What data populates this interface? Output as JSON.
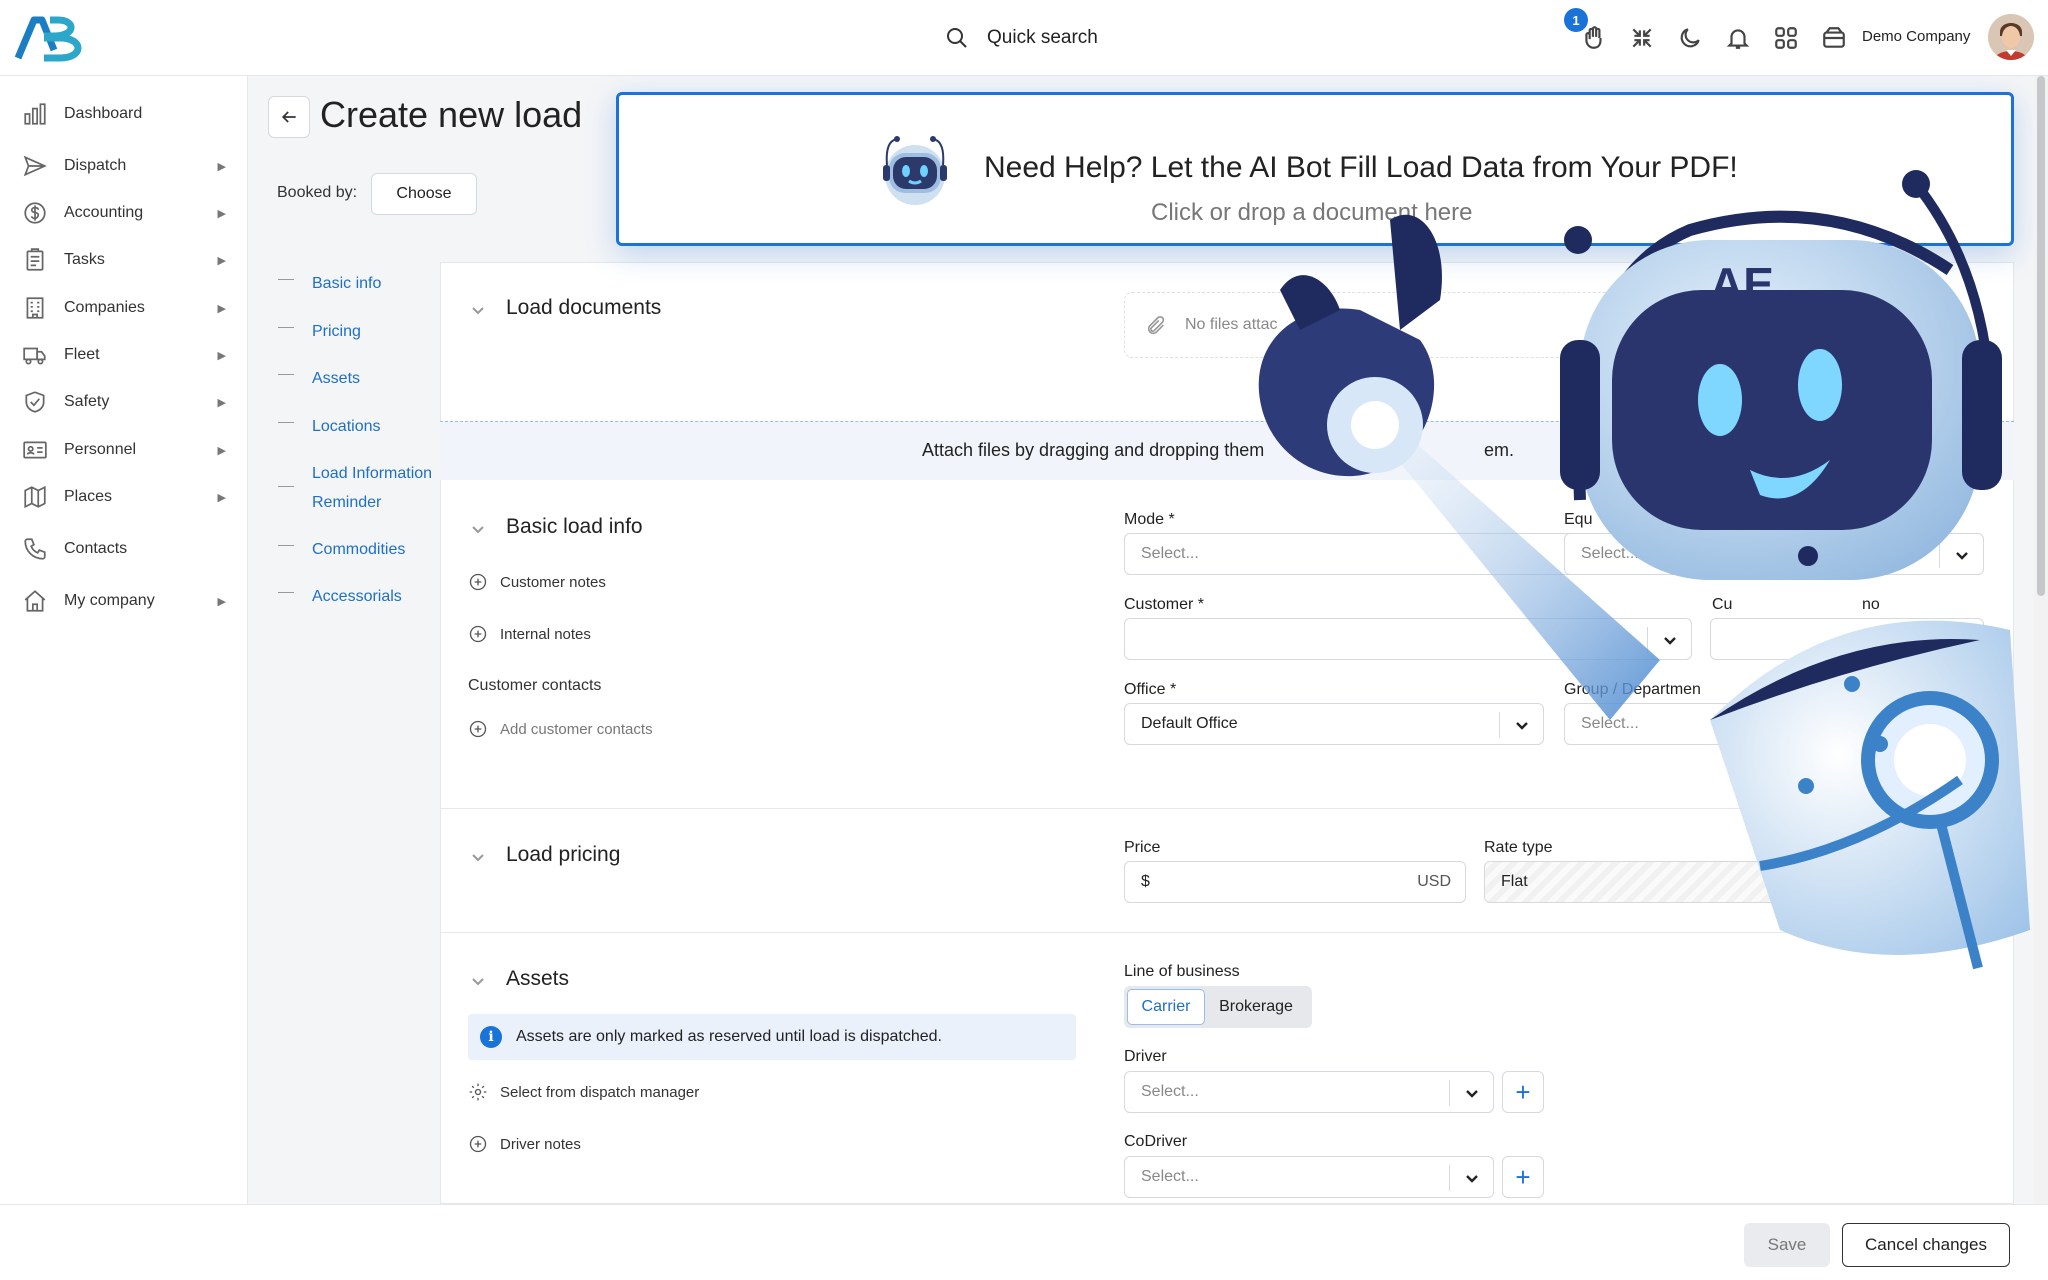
{
  "header": {
    "search_label": "Quick search",
    "notification_count": "1",
    "company_name": "Demo Company",
    "icons": [
      "hand-icon",
      "compress-icon",
      "moon-icon",
      "bell-icon",
      "apps-grid-icon",
      "wallet-icon"
    ]
  },
  "sidebar": {
    "items": [
      {
        "label": "Dashboard",
        "icon": "bar-chart-icon",
        "has_arrow": false
      },
      {
        "label": "Dispatch",
        "icon": "send-icon",
        "has_arrow": true
      },
      {
        "label": "Accounting",
        "icon": "dollar-icon",
        "has_arrow": true
      },
      {
        "label": "Tasks",
        "icon": "clipboard-icon",
        "has_arrow": true
      },
      {
        "label": "Companies",
        "icon": "building-icon",
        "has_arrow": true
      },
      {
        "label": "Fleet",
        "icon": "truck-icon",
        "has_arrow": true
      },
      {
        "label": "Safety",
        "icon": "shield-icon",
        "has_arrow": true
      },
      {
        "label": "Personnel",
        "icon": "id-card-icon",
        "has_arrow": true
      },
      {
        "label": "Places",
        "icon": "map-icon",
        "has_arrow": true
      },
      {
        "label": "Contacts",
        "icon": "phone-icon",
        "has_arrow": false
      },
      {
        "label": "My company",
        "icon": "home-icon",
        "has_arrow": true
      }
    ]
  },
  "page": {
    "title": "Create new load",
    "booked_by_label": "Booked by:",
    "choose_label": "Choose"
  },
  "toc": {
    "items": [
      "Basic info",
      "Pricing",
      "Assets",
      "Locations",
      "Load Information Reminder",
      "Commodities",
      "Accessorials"
    ]
  },
  "ai_banner": {
    "headline": "Need Help? Let the AI Bot Fill Load Data from Your PDF!",
    "subtext": "Click or drop a document here"
  },
  "sections": {
    "load_documents": {
      "title": "Load documents",
      "files_placeholder": "No files attac",
      "drop_text": "Attach files by dragging and dropping them",
      "drop_text_tail": "em."
    },
    "basic_info": {
      "title": "Basic load info",
      "customer_notes": "Customer notes",
      "internal_notes": "Internal notes",
      "customer_contacts": "Customer contacts",
      "add_customer_contacts": "Add customer contacts",
      "mode_label": "Mode *",
      "mode_placeholder": "Select...",
      "equipment_label": "Equ",
      "equipment_placeholder": "Select...",
      "customer_label": "Customer *",
      "customer_value": "",
      "customer_ref_label_start": "Cu",
      "customer_ref_label_end": "no",
      "office_label": "Office *",
      "office_value": "Default Office",
      "group_label": "Group / Departmen",
      "group_placeholder": "Select..."
    },
    "pricing": {
      "title": "Load pricing",
      "price_label": "Price",
      "currency_symbol": "$",
      "currency": "USD",
      "rate_type_label": "Rate type",
      "rate_type_value": "Flat"
    },
    "assets": {
      "title": "Assets",
      "info": "Assets are only marked as reserved until load is dispatched.",
      "select_dispatch": "Select from dispatch manager",
      "driver_notes": "Driver notes",
      "line_of_business_label": "Line of business",
      "lob_options": [
        "Carrier",
        "Brokerage"
      ],
      "lob_selected": "Carrier",
      "driver_label": "Driver",
      "driver_placeholder": "Select...",
      "codriver_label": "CoDriver",
      "codriver_placeholder": "Select..."
    }
  },
  "footer": {
    "save_label": "Save",
    "cancel_label": "Cancel changes"
  },
  "colors": {
    "accent": "#1a73d9",
    "link": "#1f6fc5"
  }
}
